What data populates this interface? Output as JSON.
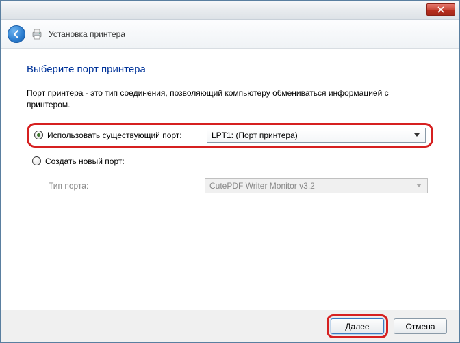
{
  "header": {
    "title": "Установка принтера"
  },
  "page": {
    "title": "Выберите порт принтера",
    "description": "Порт принтера - это тип соединения, позволяющий компьютеру обмениваться информацией с принтером."
  },
  "options": {
    "existing": {
      "label": "Использовать существующий порт:",
      "value": "LPT1: (Порт принтера)"
    },
    "new": {
      "label": "Создать новый порт:",
      "typeLabel": "Тип порта:",
      "typeValue": "CutePDF Writer Monitor v3.2"
    }
  },
  "buttons": {
    "next": "Далее",
    "cancel": "Отмена"
  }
}
